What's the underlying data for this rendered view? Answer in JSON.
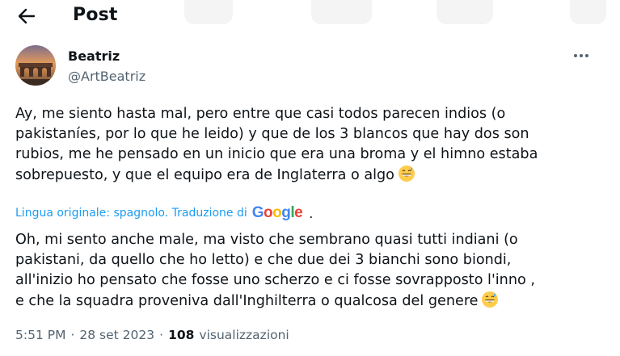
{
  "header": {
    "title": "Post",
    "back_icon": "arrow-left-icon"
  },
  "author": {
    "name": "Beatriz",
    "handle": "@ArtBeatriz",
    "avatar_icon": "avatar-image"
  },
  "post": {
    "original_text": "Ay, me siento hasta mal, pero entre que casi todos parecen indios (o\npakistaníes, por lo que he leido) y que de los 3 blancos que hay dos son\nrubios, me he pensado en un inicio que era una broma y el himno estaba\nsobrepuesto, y que el equipo era de Inglaterra o algo",
    "translation_label": "Lingua originale: spagnolo. Traduzione di",
    "translation_provider": "Google",
    "translation_period": ".",
    "translated_text": "Oh, mi sento anche male, ma visto che sembrano quasi tutti indiani (o\npakistani, da quello che ho letto) e che due dei 3 bianchi sono biondi,\nall'inizio ho pensato che fosse uno scherzo e ci fosse sovrapposto l'inno ,\ne che la squadra proveniva dall'Inghilterra o qualcosa del genere",
    "emoji": "grinning-sweat-emoji"
  },
  "meta": {
    "time": "5:51 PM",
    "separator": "·",
    "date": "28 set 2023",
    "views_count": "108",
    "views_label": "visualizzazioni"
  },
  "colors": {
    "link": "#1d9bf0",
    "secondary": "#536471",
    "text": "#0f1419"
  }
}
